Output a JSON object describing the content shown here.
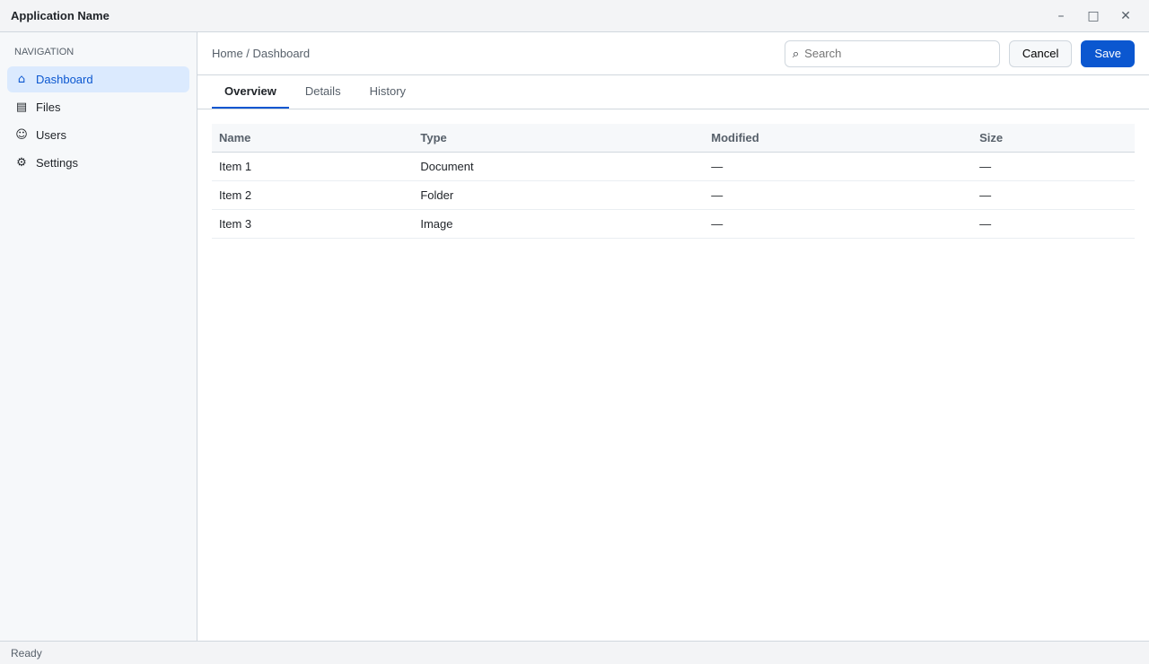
{
  "window": {
    "title": "Application Name"
  },
  "sidebar": {
    "heading": "Navigation",
    "items": [
      {
        "label": "Dashboard",
        "icon": "home-icon",
        "active": true
      },
      {
        "label": "Files",
        "icon": "folder-icon",
        "active": false
      },
      {
        "label": "Users",
        "icon": "user-icon",
        "active": false
      },
      {
        "label": "Settings",
        "icon": "gear-icon",
        "active": false
      }
    ]
  },
  "toolbar": {
    "breadcrumb": "Home / Dashboard",
    "search_placeholder": "Search",
    "secondary_label": "Cancel",
    "primary_label": "Save"
  },
  "tabs": [
    {
      "label": "Overview",
      "active": true
    },
    {
      "label": "Details",
      "active": false
    },
    {
      "label": "History",
      "active": false
    }
  ],
  "table": {
    "columns": [
      "Name",
      "Type",
      "Modified",
      "Size"
    ],
    "rows": [
      [
        "Item 1",
        "Document",
        "—",
        "—"
      ],
      [
        "Item 2",
        "Folder",
        "—",
        "—"
      ],
      [
        "Item 3",
        "Image",
        "—",
        "—"
      ]
    ]
  },
  "status": {
    "left": "Ready",
    "right": ""
  },
  "colors": {
    "accent": "#0b57d0",
    "sidebar_bg": "#f6f8fa"
  }
}
